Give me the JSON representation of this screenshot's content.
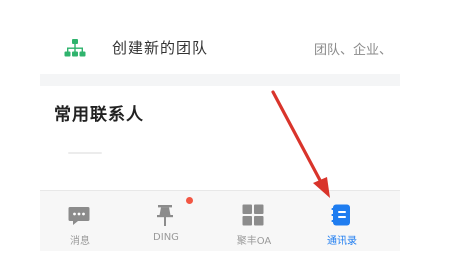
{
  "create_team": {
    "label": "创建新的团队",
    "description": "团队、企业、",
    "icon": "team-tree-icon",
    "icon_color": "#2fb36d"
  },
  "frequent_contacts": {
    "title": "常用联系人"
  },
  "bottom_nav": {
    "items": [
      {
        "label": "消息",
        "icon": "chat-bubble-icon",
        "active": false
      },
      {
        "label": "DING",
        "icon": "pin-icon",
        "active": false,
        "badge": true
      },
      {
        "label": "聚丰OA",
        "icon": "grid-apps-icon",
        "active": false
      },
      {
        "label": "通讯录",
        "icon": "address-book-icon",
        "active": true
      }
    ],
    "active_color": "#1f7df0",
    "inactive_color": "#8c8c8c",
    "badge_color": "#f25643"
  },
  "annotation": {
    "type": "red-arrow",
    "color": "#d9342b",
    "points_to": "通讯录"
  }
}
